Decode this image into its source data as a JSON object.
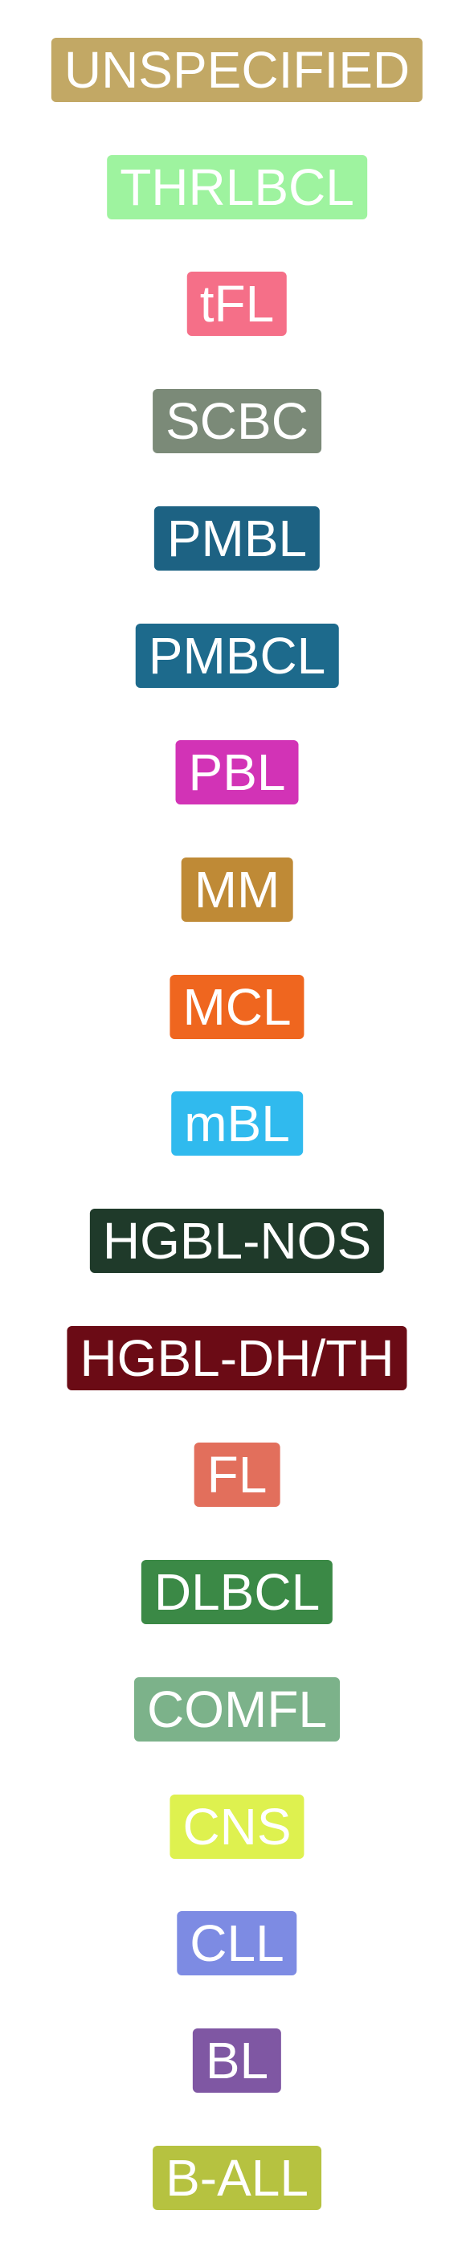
{
  "labels": [
    {
      "text": "UNSPECIFIED",
      "color": "#C2A865"
    },
    {
      "text": "THRLBCL",
      "color": "#9EF39F"
    },
    {
      "text": "tFL",
      "color": "#F56F88"
    },
    {
      "text": "SCBC",
      "color": "#7B8A78"
    },
    {
      "text": "PMBL",
      "color": "#1D6283"
    },
    {
      "text": "PMBCL",
      "color": "#1D6A8C"
    },
    {
      "text": "PBL",
      "color": "#D233B6"
    },
    {
      "text": "MM",
      "color": "#BF8A36"
    },
    {
      "text": "MCL",
      "color": "#EF661F"
    },
    {
      "text": "mBL",
      "color": "#30BAEE"
    },
    {
      "text": "HGBL-NOS",
      "color": "#1F3A2A"
    },
    {
      "text": "HGBL-DH/TH",
      "color": "#6B0B15"
    },
    {
      "text": "FL",
      "color": "#E26F5C"
    },
    {
      "text": "DLBCL",
      "color": "#3B8946"
    },
    {
      "text": "COMFL",
      "color": "#7CB28A"
    },
    {
      "text": "CNS",
      "color": "#DEF14F"
    },
    {
      "text": "CLL",
      "color": "#7D8BE3"
    },
    {
      "text": "BL",
      "color": "#7F57A3"
    },
    {
      "text": "B-ALL",
      "color": "#B6C240"
    }
  ]
}
